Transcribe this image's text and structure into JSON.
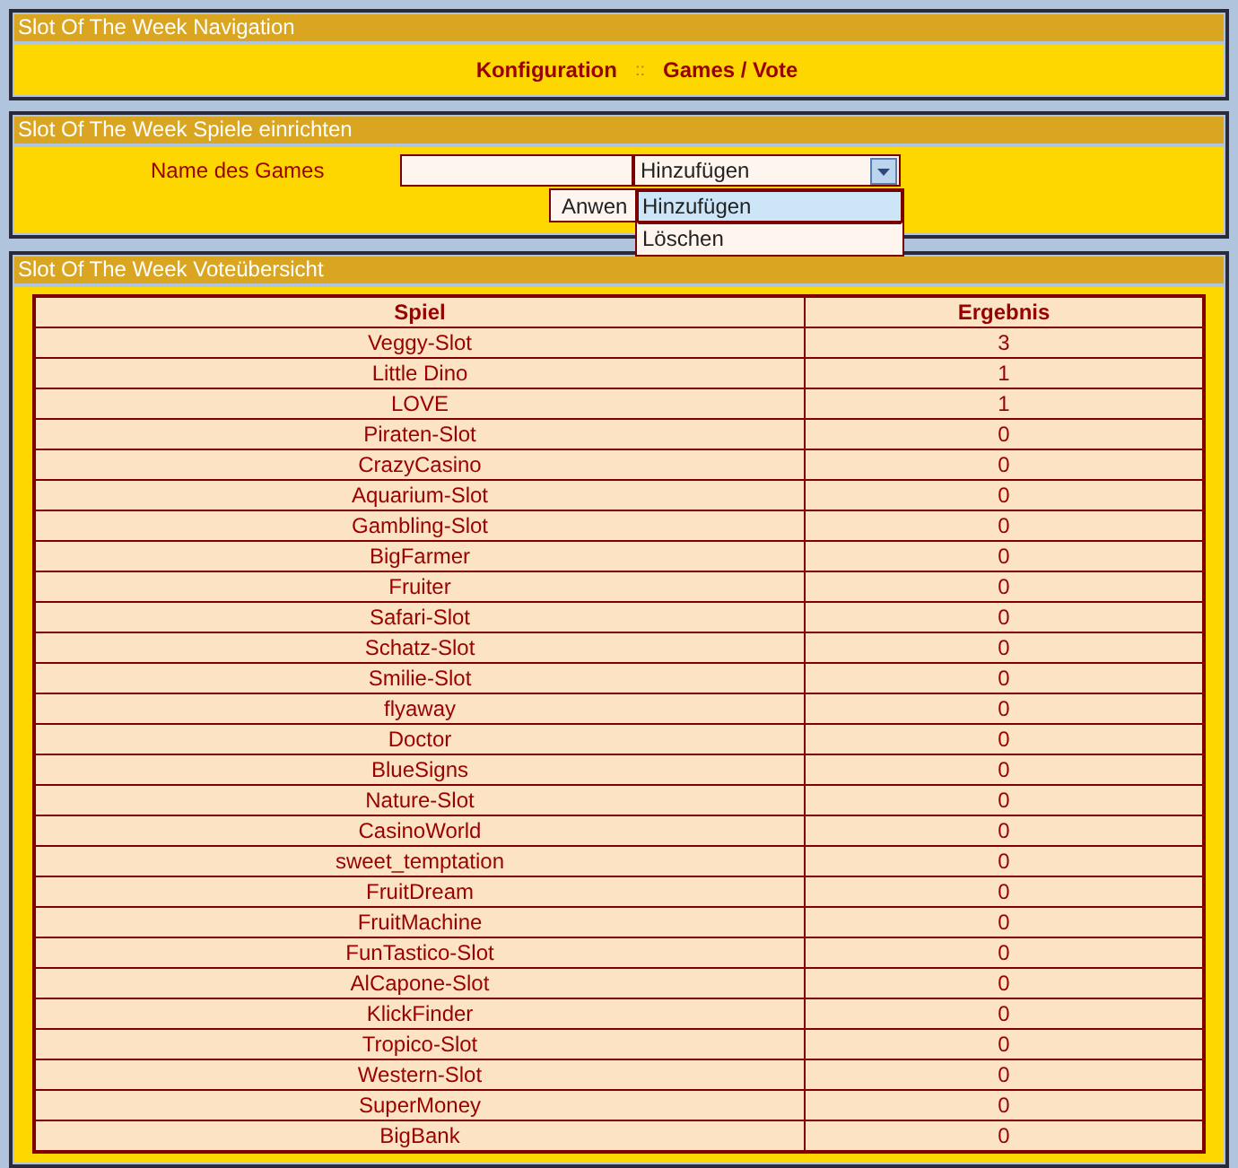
{
  "navigation": {
    "title": "Slot Of The Week Navigation",
    "links": [
      {
        "label": "Konfiguration"
      },
      {
        "label": "Games / Vote"
      }
    ],
    "separator": "::"
  },
  "setup": {
    "title": "Slot Of The Week Spiele einrichten",
    "label": "Name des Games",
    "select": {
      "value": "Hinzufügen",
      "expanded": true,
      "options": [
        {
          "label": "Hinzufügen",
          "selected": true
        },
        {
          "label": "Löschen",
          "selected": false
        }
      ]
    },
    "button": "Anwen"
  },
  "votes": {
    "title": "Slot Of The Week Voteübersicht",
    "columns": [
      "Spiel",
      "Ergebnis"
    ],
    "rows": [
      {
        "game": "Veggy-Slot",
        "result": "3"
      },
      {
        "game": "Little Dino",
        "result": "1"
      },
      {
        "game": "LOVE",
        "result": "1"
      },
      {
        "game": "Piraten-Slot",
        "result": "0"
      },
      {
        "game": "CrazyCasino",
        "result": "0"
      },
      {
        "game": "Aquarium-Slot",
        "result": "0"
      },
      {
        "game": "Gambling-Slot",
        "result": "0"
      },
      {
        "game": "BigFarmer",
        "result": "0"
      },
      {
        "game": "Fruiter",
        "result": "0"
      },
      {
        "game": "Safari-Slot",
        "result": "0"
      },
      {
        "game": "Schatz-Slot",
        "result": "0"
      },
      {
        "game": "Smilie-Slot",
        "result": "0"
      },
      {
        "game": "flyaway",
        "result": "0"
      },
      {
        "game": "Doctor",
        "result": "0"
      },
      {
        "game": "BlueSigns",
        "result": "0"
      },
      {
        "game": "Nature-Slot",
        "result": "0"
      },
      {
        "game": "CasinoWorld",
        "result": "0"
      },
      {
        "game": "sweet_temptation",
        "result": "0"
      },
      {
        "game": "FruitDream",
        "result": "0"
      },
      {
        "game": "FruitMachine",
        "result": "0"
      },
      {
        "game": "FunTastico-Slot",
        "result": "0"
      },
      {
        "game": "AlCapone-Slot",
        "result": "0"
      },
      {
        "game": "KlickFinder",
        "result": "0"
      },
      {
        "game": "Tropico-Slot",
        "result": "0"
      },
      {
        "game": "Western-Slot",
        "result": "0"
      },
      {
        "game": "SuperMoney",
        "result": "0"
      },
      {
        "game": "BigBank",
        "result": "0"
      }
    ]
  }
}
